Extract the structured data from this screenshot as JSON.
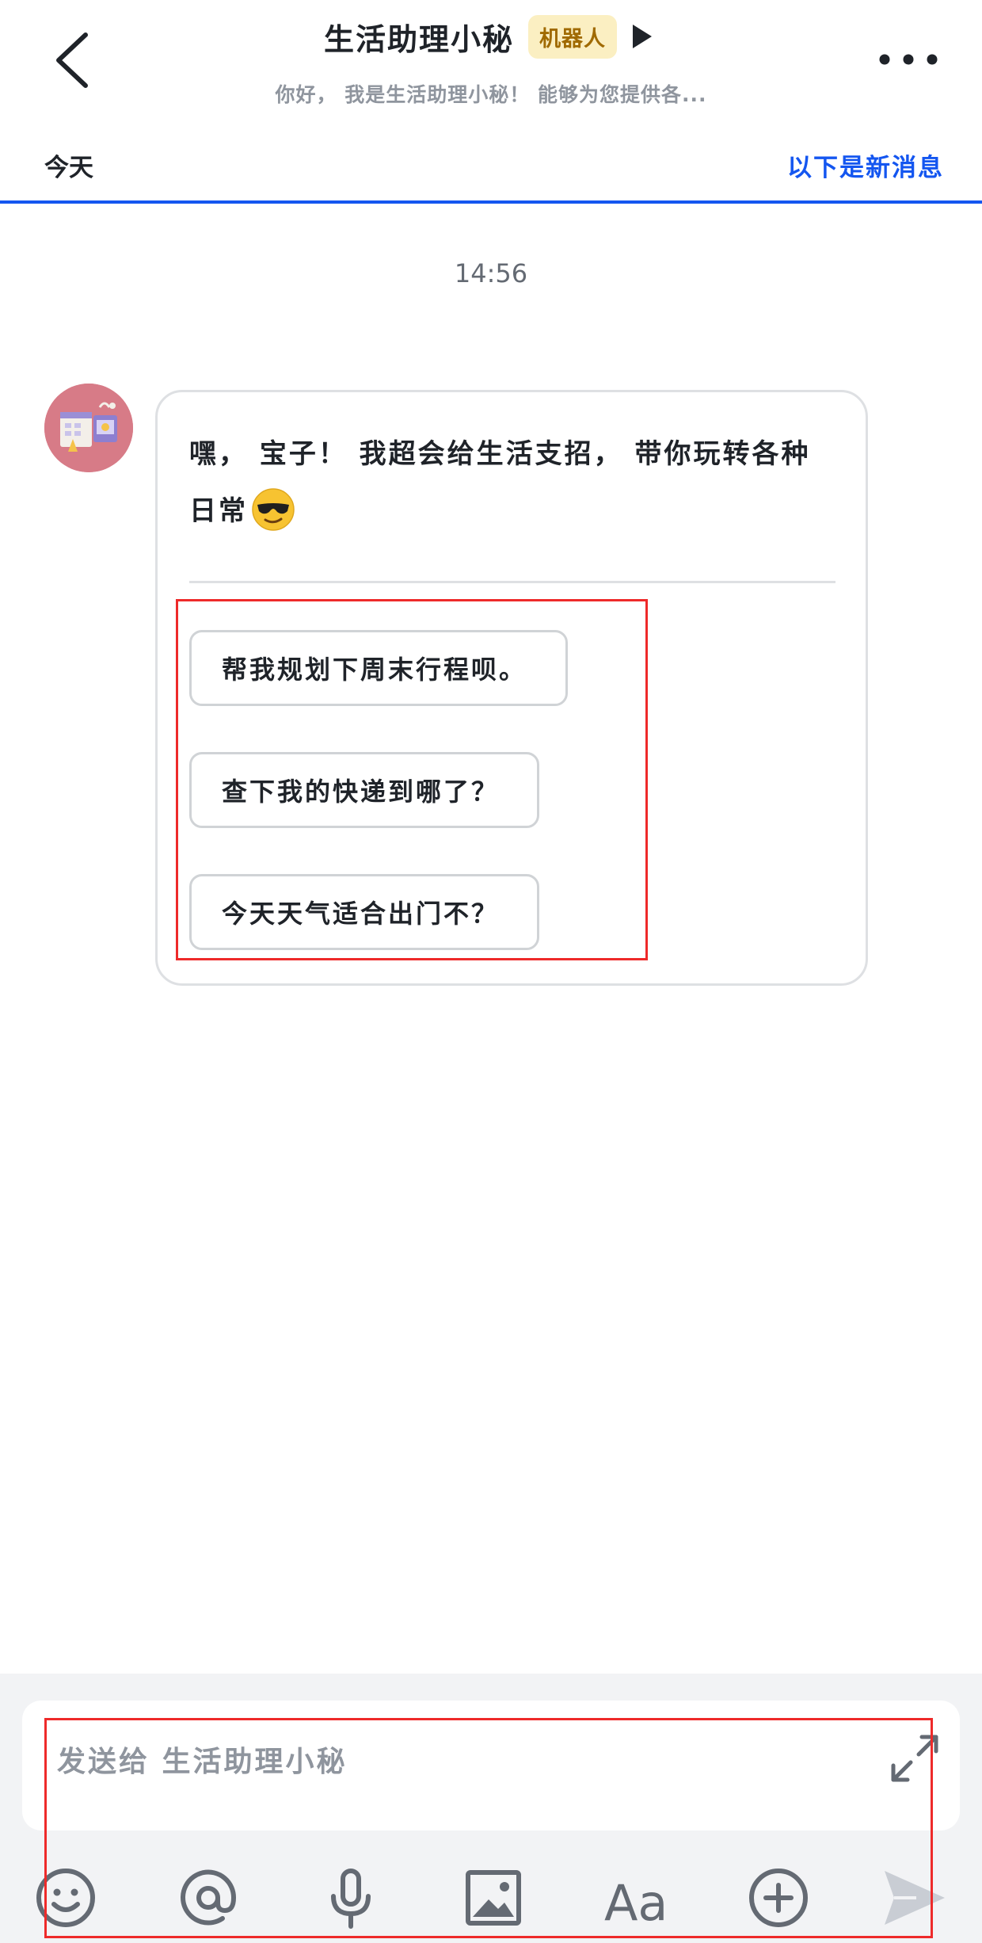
{
  "header": {
    "title": "生活助理小秘",
    "badge": "机器人",
    "subtitle": "你好， 我是生活助理小秘！ 能够为您提供各..."
  },
  "day_bar": {
    "today_label": "今天",
    "new_messages_label": "以下是新消息"
  },
  "chat": {
    "timestamp": "14:56",
    "message": {
      "text": "嘿， 宝子！ 我超会给生活支招， 带你玩转各种日常",
      "emoji": "smiling-face-with-sunglasses"
    },
    "suggestions": [
      {
        "label": "帮我规划下周末行程呗。"
      },
      {
        "label": "查下我的快递到哪了？"
      },
      {
        "label": "今天天气适合出门不？"
      }
    ]
  },
  "composer": {
    "placeholder": "发送给  生活助理小秘",
    "toolbar": [
      "emoji-icon",
      "at-mention-icon",
      "microphone-icon",
      "image-icon",
      "text-format-icon",
      "plus-circle-icon",
      "send-icon"
    ],
    "font_tool_label": "Aa"
  },
  "colors": {
    "accent": "#1456f0",
    "badge_bg": "#fbefc2",
    "badge_text": "#a06a00",
    "annotation_red": "#ee2a2a",
    "composer_bg": "#f2f3f5"
  }
}
